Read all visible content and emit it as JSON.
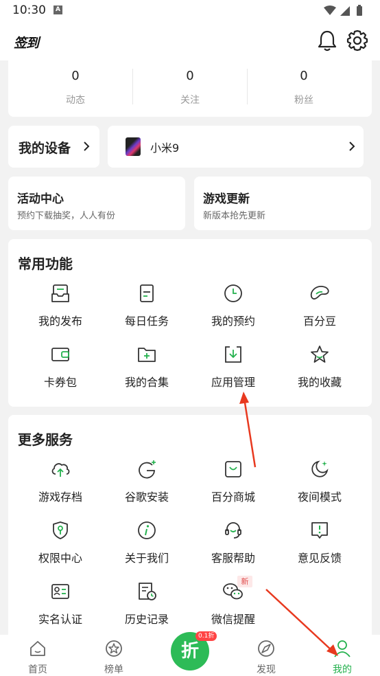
{
  "status_bar": {
    "time": "10:30",
    "notify_badge": "A"
  },
  "header": {
    "signin_label": "签到"
  },
  "stats": [
    {
      "value": "0",
      "label": "动态"
    },
    {
      "value": "0",
      "label": "关注"
    },
    {
      "value": "0",
      "label": "粉丝"
    }
  ],
  "device": {
    "section_label": "我的设备",
    "device_name": "小米9"
  },
  "promos": [
    {
      "title": "活动中心",
      "subtitle": "预约下载抽奖，人人有份"
    },
    {
      "title": "游戏更新",
      "subtitle": "新版本抢先更新"
    }
  ],
  "common_functions": {
    "title": "常用功能",
    "items": [
      {
        "label": "我的发布",
        "icon": "publish-icon"
      },
      {
        "label": "每日任务",
        "icon": "task-icon"
      },
      {
        "label": "我的预约",
        "icon": "clock-icon"
      },
      {
        "label": "百分豆",
        "icon": "bean-icon"
      },
      {
        "label": "卡券包",
        "icon": "wallet-icon"
      },
      {
        "label": "我的合集",
        "icon": "folder-plus-icon"
      },
      {
        "label": "应用管理",
        "icon": "download-box-icon"
      },
      {
        "label": "我的收藏",
        "icon": "star-icon"
      }
    ]
  },
  "more_services": {
    "title": "更多服务",
    "items": [
      {
        "label": "游戏存档",
        "icon": "cloud-upload-icon"
      },
      {
        "label": "谷歌安装",
        "icon": "google-icon"
      },
      {
        "label": "百分商城",
        "icon": "shopping-bag-icon"
      },
      {
        "label": "夜间模式",
        "icon": "moon-icon"
      },
      {
        "label": "权限中心",
        "icon": "shield-key-icon"
      },
      {
        "label": "关于我们",
        "icon": "info-icon"
      },
      {
        "label": "客服帮助",
        "icon": "headset-icon"
      },
      {
        "label": "意见反馈",
        "icon": "feedback-icon"
      },
      {
        "label": "实名认证",
        "icon": "id-card-icon"
      },
      {
        "label": "历史记录",
        "icon": "history-icon"
      },
      {
        "label": "微信提醒",
        "icon": "wechat-icon"
      }
    ],
    "new_badge": "新"
  },
  "tab_bar": {
    "tabs": [
      {
        "label": "首页",
        "icon": "home-icon"
      },
      {
        "label": "榜单",
        "icon": "ranking-icon"
      },
      {
        "label": "发现",
        "icon": "discover-icon"
      },
      {
        "label": "我的",
        "icon": "profile-icon"
      }
    ],
    "center_label": "折",
    "center_badge": "0.1折",
    "active_color": "#23b14d"
  },
  "colors": {
    "accent": "#23b14d",
    "annotation_arrow": "#e8391f"
  }
}
